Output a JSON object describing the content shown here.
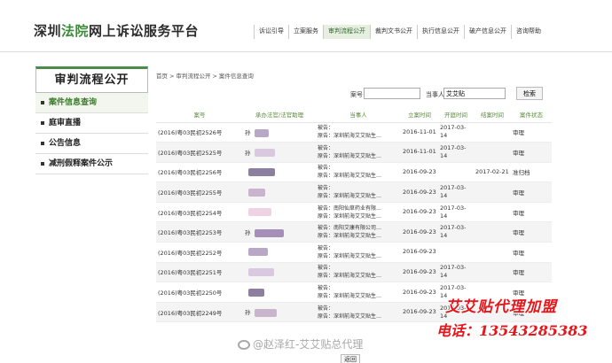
{
  "header": {
    "logo_region": "深圳",
    "logo_court": "法院",
    "logo_rest": "网上诉讼服务平台",
    "nav": [
      {
        "label": "诉讼引导",
        "active": false
      },
      {
        "label": "立案服务",
        "active": false
      },
      {
        "label": "审判流程公开",
        "active": true
      },
      {
        "label": "裁判文书公开",
        "active": false
      },
      {
        "label": "执行信息公开",
        "active": false
      },
      {
        "label": "破产信息公开",
        "active": false
      },
      {
        "label": "咨询帮助",
        "active": false
      }
    ]
  },
  "sidebar": {
    "title": "审判流程公开",
    "items": [
      {
        "label": "案件信息查询",
        "active": true
      },
      {
        "label": "庭审直播",
        "active": false
      },
      {
        "label": "公告信息",
        "active": false
      },
      {
        "label": "减刑假释案件公示",
        "active": false
      }
    ]
  },
  "breadcrumb": [
    "首页",
    ">",
    "审判流程公开",
    ">",
    "案件信息查询"
  ],
  "search": {
    "case_no_label": "案号",
    "case_no_value": "",
    "party_label": "当事人",
    "party_value": "艾艾贴",
    "button_label": "检索"
  },
  "table": {
    "headers": [
      "案号",
      "承办法官/法官助理",
      "当事人",
      "立案时间",
      "开庭时间",
      "结案时间",
      "案件状态"
    ],
    "rows": [
      {
        "case_no": "(2016)粤03民初2526号",
        "judge": "孙",
        "party1": "被告：",
        "party2": "原告：深圳前海艾艾贴生…",
        "filed": "2016-11-01",
        "hearing": "2017-03-14",
        "closed": "",
        "status": "审理"
      },
      {
        "case_no": "(2016)粤03民初2525号",
        "judge": "孙",
        "party1": "被告：",
        "party2": "原告：深圳前海艾艾贴生…",
        "filed": "2016-11-01",
        "hearing": "2017-03-14",
        "closed": "",
        "status": "审理"
      },
      {
        "case_no": "(2016)粤03民初2256号",
        "judge": "",
        "party1": "被告：",
        "party2": "原告：深圳前海艾艾贴生…",
        "filed": "2016-09-23",
        "hearing": "",
        "closed": "2017-02-21",
        "status": "准归档"
      },
      {
        "case_no": "(2016)粤03民初2255号",
        "judge": "",
        "party1": "被告：",
        "party2": "原告：深圳前海艾艾贴生…",
        "filed": "2016-09-23",
        "hearing": "2017-03-14",
        "closed": "",
        "status": "审理"
      },
      {
        "case_no": "(2016)粤03民初2254号",
        "judge": "",
        "party1": "被告：南阳仙草药业有限…",
        "party2": "原告：深圳前海艾艾贴生…",
        "filed": "2016-09-23",
        "hearing": "2017-03-14",
        "closed": "",
        "status": "审理"
      },
      {
        "case_no": "(2016)粤03民初2253号",
        "judge": "孙",
        "party1": "被告：南阳艾康有限公司…",
        "party2": "原告：深圳前海艾艾贴生…",
        "filed": "2016-09-23",
        "hearing": "2017-03-14",
        "closed": "",
        "status": "审理"
      },
      {
        "case_no": "(2016)粤03民初2252号",
        "judge": "",
        "party1": "被告：",
        "party2": "原告：深圳前海艾艾贴生…",
        "filed": "2016-09-23",
        "hearing": "",
        "closed": "",
        "status": "审理"
      },
      {
        "case_no": "(2016)粤03民初2251号",
        "judge": "",
        "party1": "被告：",
        "party2": "原告：深圳前海艾艾贴生…",
        "filed": "2016-09-23",
        "hearing": "2017-03-14",
        "closed": "",
        "status": "审理"
      },
      {
        "case_no": "(2016)粤03民初2250号",
        "judge": "",
        "party1": "被告：",
        "party2": "原告：深圳前海艾艾贴生…",
        "filed": "2016-09-23",
        "hearing": "2017-03-14",
        "closed": "",
        "status": "审理"
      },
      {
        "case_no": "(2016)粤03民初2249号",
        "judge": "孙",
        "party1": "被告：",
        "party2": "原告：深圳前海艾艾贴生…",
        "filed": "2016-09-23",
        "hearing": "2017-03-14",
        "closed": "",
        "status": "审理"
      }
    ]
  },
  "footer": {
    "back_label": "返回"
  },
  "watermark": {
    "text": "@赵泽红-艾艾贴总代理"
  },
  "ad": {
    "line1": "艾艾贴代理加盟",
    "line2": "电话：13543285383"
  },
  "colors": {
    "accent_green": "#4b8b4b",
    "header_green": "#5a8a3a",
    "ad_red": "#e6161b"
  }
}
